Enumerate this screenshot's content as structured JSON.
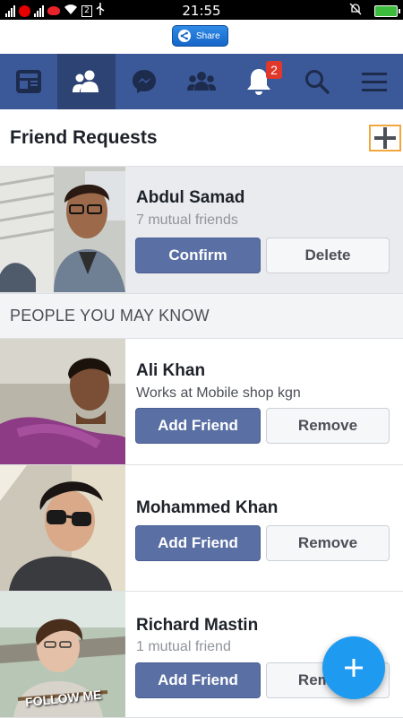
{
  "status_bar": {
    "time": "21:55"
  },
  "share": {
    "label": "Share"
  },
  "nav": {
    "items": [
      {
        "icon": "news-feed-icon"
      },
      {
        "icon": "friend-requests-icon",
        "active": true
      },
      {
        "icon": "messenger-icon"
      },
      {
        "icon": "groups-icon"
      },
      {
        "icon": "notifications-icon",
        "badge": "2"
      },
      {
        "icon": "search-icon"
      },
      {
        "icon": "menu-icon"
      }
    ]
  },
  "header": {
    "title": "Friend Requests"
  },
  "requests": [
    {
      "name": "Abdul Samad",
      "subtitle": "7 mutual friends",
      "primary": "Confirm",
      "secondary": "Delete"
    }
  ],
  "section": {
    "title": "PEOPLE YOU MAY KNOW"
  },
  "suggestions": [
    {
      "name": "Ali Khan",
      "subtitle": "Works at Mobile shop kgn",
      "primary": "Add Friend",
      "secondary": "Remove"
    },
    {
      "name": "Mohammed Khan",
      "subtitle": "",
      "primary": "Add Friend",
      "secondary": "Remove"
    },
    {
      "name": "Richard Mastin",
      "subtitle": "1 mutual friend",
      "primary": "Add Friend",
      "secondary": "Remove",
      "photo_caption": "FOLLOW ME"
    }
  ],
  "colors": {
    "brand": "#3b5998",
    "active_nav": "#2d4373",
    "fab": "#1e9bf0",
    "badge": "#e0392b"
  }
}
